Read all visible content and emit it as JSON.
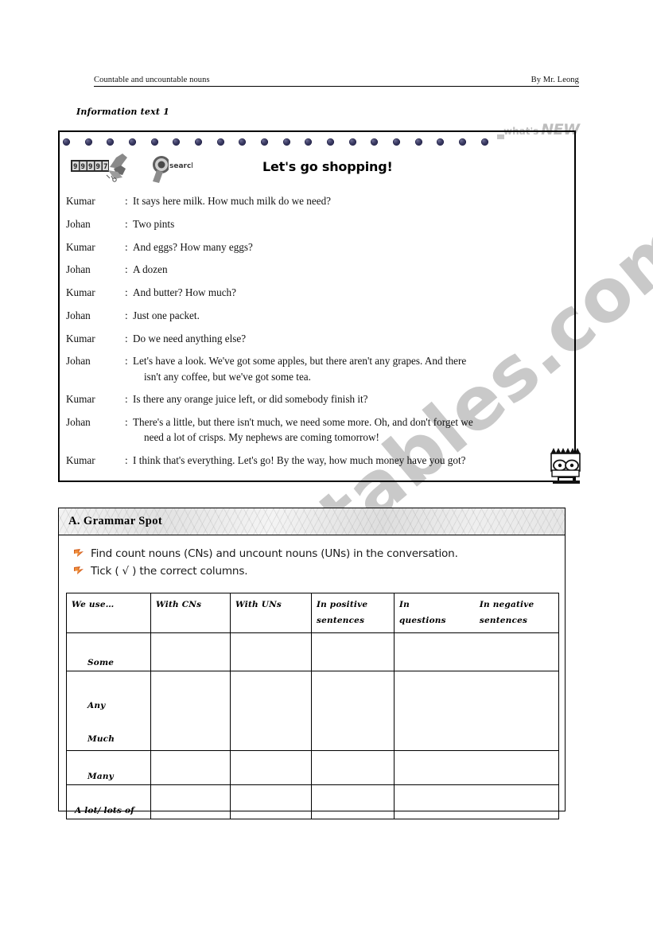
{
  "header": {
    "left_title": "Countable and uncountable nouns",
    "right_credit": "By Mr. Leong"
  },
  "info_label": "Information text 1",
  "whats_new": {
    "small": "what's",
    "big": "NEW"
  },
  "dialogue_box": {
    "title": "Let's go shopping!",
    "lines": [
      {
        "speaker": "Kumar",
        "colon": ":",
        "text": "It says here milk. How much milk do we need?",
        "cont": ""
      },
      {
        "speaker": "Johan",
        "colon": ":",
        "text": "Two pints",
        "cont": ""
      },
      {
        "speaker": "Kumar",
        "colon": ":",
        "text": "And eggs? How many eggs?",
        "cont": ""
      },
      {
        "speaker": "Johan",
        "colon": ":",
        "text": "A dozen",
        "cont": ""
      },
      {
        "speaker": "Kumar",
        "colon": ":",
        "text": "And butter? How much?",
        "cont": ""
      },
      {
        "speaker": "Johan",
        "colon": ":",
        "text": "Just one packet.",
        "cont": ""
      },
      {
        "speaker": "Kumar",
        "colon": ":",
        "text": "Do we need anything else?",
        "cont": ""
      },
      {
        "speaker": "Johan",
        "colon": ":",
        "text": "Let's have a look. We've got some apples, but there aren't any grapes. And there",
        "cont": "isn't any coffee, but we've got some tea."
      },
      {
        "speaker": "Kumar",
        "colon": ":",
        "text": "Is there any orange juice left, or did somebody finish it?",
        "cont": ""
      },
      {
        "speaker": "Johan",
        "colon": ":",
        "text": "There's a little, but there isn't much, we need some more. Oh, and don't forget we",
        "cont": "need a lot of crisps. My nephews are coming tomorrow!"
      },
      {
        "speaker": "Kumar",
        "colon": ":",
        "text": "I think that's everything. Let's go! By the way, how much money have you got?",
        "cont": ""
      }
    ],
    "clipart": {
      "odometer": "odometer-counter-clipart",
      "search": "magnifying-glass-search-clipart",
      "bart": "cartoon-boy-face-clipart"
    },
    "bead_count": 20
  },
  "grammar_spot": {
    "title": "A. Grammar Spot",
    "instructions": [
      "Find count nouns (CNs) and uncount nouns (UNs) in the conversation.",
      "Tick ( √ ) the correct columns."
    ],
    "table": {
      "headers": {
        "col1": "We use…",
        "col2": "With CNs",
        "col3": "With UNs",
        "col4_line1": "In positive",
        "col4_line2": "sentences",
        "col5a_line1": "In",
        "col5a_line2": "questions",
        "col5b_line1": "In negative",
        "col5b_line2": "sentences"
      },
      "rows": [
        {
          "label": "Some",
          "label2": "",
          "cells": [
            "",
            "",
            "",
            ""
          ]
        },
        {
          "label": "Any",
          "label2": "Much",
          "cells": [
            "",
            "",
            "",
            ""
          ]
        },
        {
          "label": "Many",
          "label2": "",
          "cells": [
            "",
            "",
            "",
            ""
          ]
        },
        {
          "label": "A lot/ lots of",
          "label2": "",
          "cells": [
            "",
            "",
            "",
            ""
          ]
        }
      ]
    }
  },
  "watermark": {
    "text": "ESLprintables.com"
  },
  "colors": {
    "bead": "#2d2d56",
    "bullet": "#d4601f",
    "watermark": "#c9c9c9",
    "ink": "#111111"
  }
}
